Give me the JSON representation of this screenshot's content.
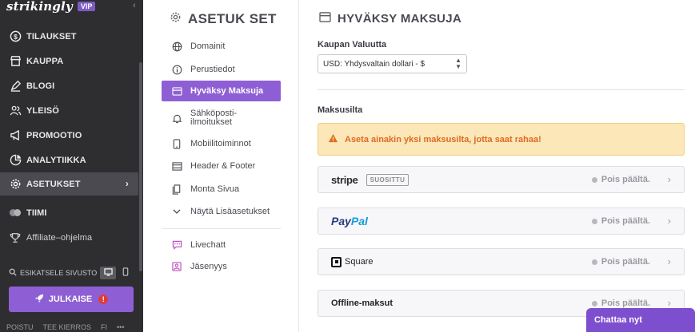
{
  "brand": {
    "logo": "strikingly",
    "badge": "VIP"
  },
  "sidebar": {
    "items": [
      {
        "label": "TILAUKSET",
        "icon": "dollar-icon"
      },
      {
        "label": "KAUPPA",
        "icon": "store-icon"
      },
      {
        "label": "BLOGI",
        "icon": "pen-icon"
      },
      {
        "label": "YLEISÖ",
        "icon": "people-icon"
      },
      {
        "label": "PROMOOTIO",
        "icon": "megaphone-icon"
      },
      {
        "label": "ANALYTIIKKA",
        "icon": "chart-icon"
      },
      {
        "label": "ASETUKSET",
        "icon": "gear-icon",
        "active": true
      },
      {
        "label": "TIIMI",
        "icon": "team-icon"
      },
      {
        "label": "Affiliate–ohjelma",
        "icon": "trophy-icon"
      }
    ],
    "preview_label": "ESIKATSELE SIVUSTO",
    "publish_label": "JULKAISE",
    "publish_alert": "!",
    "footer": [
      "POISTU",
      "TEE KIERROS",
      "FI",
      "•••"
    ]
  },
  "subnav": {
    "title": "ASETUK SET",
    "items": [
      {
        "label": "Domainit",
        "icon": "globe-icon"
      },
      {
        "label": "Perustiedot",
        "icon": "info-icon"
      },
      {
        "label": "Hyväksy Maksuja",
        "icon": "card-icon",
        "active": true
      },
      {
        "label_line1": "Sähköposti-",
        "label_line2": "ilmoitukset",
        "icon": "bell-icon"
      },
      {
        "label": "Mobiilitoiminnot",
        "icon": "mobile-icon"
      },
      {
        "label": "Header & Footer",
        "icon": "layout-icon"
      },
      {
        "label": "Monta Sivua",
        "icon": "pages-icon"
      },
      {
        "label": "Näytä Lisäasetukset",
        "icon": "chevron-down-icon"
      },
      {
        "label": "Livechatt",
        "icon": "chat-icon"
      },
      {
        "label": "Jäsenyys",
        "icon": "member-icon"
      }
    ]
  },
  "main": {
    "title": "HYVÄKSY MAKSUJA",
    "currency_label": "Kaupan Valuutta",
    "currency_value": "USD: Yhdysvaltain dollari - $",
    "gateways_label": "Maksusilta",
    "warning": "Aseta ainakin yksi maksusilta, jotta saat rahaa!",
    "gateways": [
      {
        "name": "stripe",
        "badge": "SUOSITTU",
        "status": "Pois päältä."
      },
      {
        "name_part1": "Pay",
        "name_part2": "Pal",
        "status": "Pois päältä."
      },
      {
        "name": "Square",
        "status": "Pois päältä."
      },
      {
        "name": "Offline-maksut",
        "status": "Pois päältä."
      }
    ]
  },
  "chat": {
    "label": "Chattaa nyt"
  },
  "colors": {
    "accent": "#8e5fd4",
    "sidebar_bg": "#2e2e31",
    "warning_bg": "#fbe7b8",
    "warning_text": "#e06a23"
  }
}
